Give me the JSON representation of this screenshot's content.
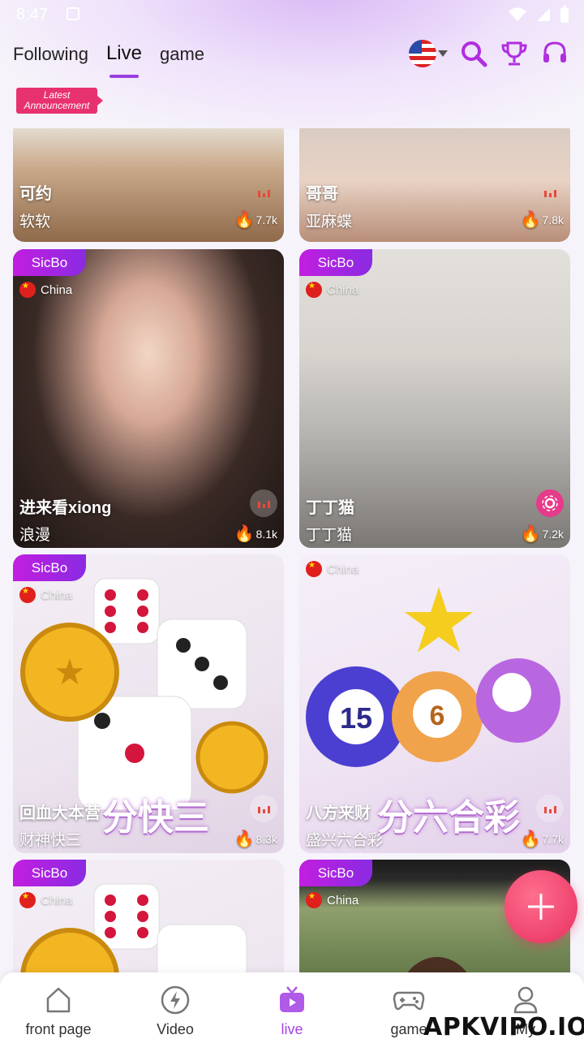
{
  "status_bar": {
    "time": "8:47"
  },
  "header": {
    "tabs": [
      {
        "label": "Following",
        "active": false
      },
      {
        "label": "Live",
        "active": true
      },
      {
        "label": "game",
        "active": false
      }
    ],
    "icons": [
      "us-flag-icon",
      "search-icon",
      "trophy-icon",
      "headset-icon"
    ]
  },
  "announcement": {
    "line1": "Latest",
    "line2": "Announcement"
  },
  "cards": [
    {
      "tag": "",
      "location": "",
      "title": "可约",
      "subtitle": "软软",
      "viewers": "7.7k"
    },
    {
      "tag": "",
      "location": "",
      "title": "哥哥",
      "subtitle": "亚麻蝶",
      "viewers": "7.8k"
    },
    {
      "tag": "SicBo",
      "location": "China",
      "title": "进来看xiong",
      "subtitle": "浪漫",
      "viewers": "8.1k"
    },
    {
      "tag": "SicBo",
      "location": "China",
      "title": "丁丁猫",
      "subtitle": "丁丁猫",
      "viewers": "7.2k"
    },
    {
      "tag": "SicBo",
      "location": "China",
      "title": "回血大本营",
      "subtitle": "财神快三",
      "viewers": "8.3k",
      "overlay": "分快三"
    },
    {
      "tag": "",
      "location": "China",
      "title": "八方来财",
      "subtitle": "盛兴六合彩",
      "viewers": "7.7k",
      "overlay": "分六合彩"
    },
    {
      "tag": "SicBo",
      "location": "China",
      "title": "",
      "subtitle": "",
      "viewers": ""
    },
    {
      "tag": "SicBo",
      "location": "China",
      "title": "",
      "subtitle": "",
      "viewers": ""
    }
  ],
  "bottom_nav": [
    {
      "label": "front page",
      "icon": "home-icon"
    },
    {
      "label": "Video",
      "icon": "lightning-icon"
    },
    {
      "label": "live",
      "icon": "tv-icon",
      "active": true
    },
    {
      "label": "game",
      "icon": "gamepad-icon"
    },
    {
      "label": "My",
      "icon": "user-icon"
    }
  ],
  "watermark": "APKVIPO.IO",
  "colors": {
    "accent": "#a244e8",
    "tag": "#b424e2",
    "fab": "#e72f5f",
    "announce": "#e8316f"
  }
}
